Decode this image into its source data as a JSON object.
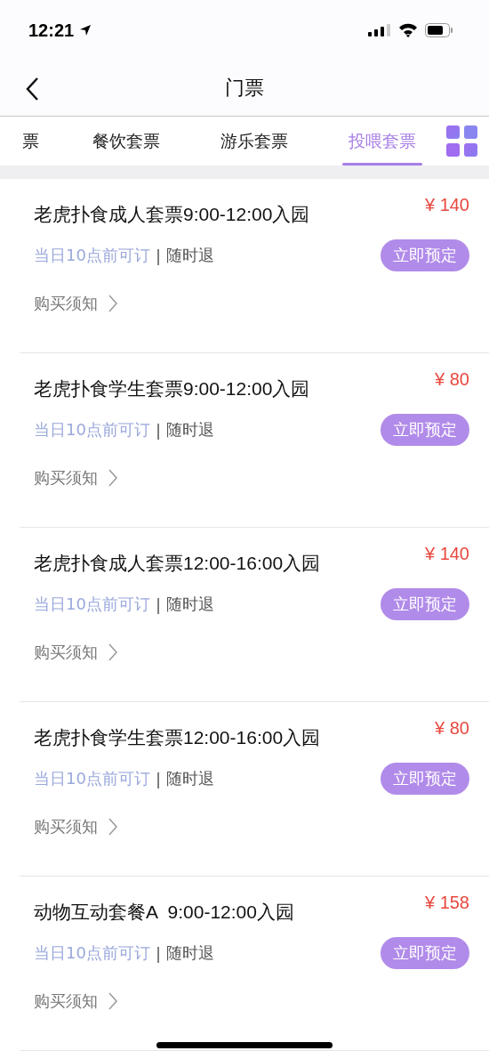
{
  "status_bar": {
    "time": "12:21"
  },
  "nav": {
    "title": "门票"
  },
  "tabs": [
    {
      "label": "票",
      "selected": false
    },
    {
      "label": "餐饮套票",
      "selected": false
    },
    {
      "label": "游乐套票",
      "selected": false
    },
    {
      "label": "投喂套票",
      "selected": true
    }
  ],
  "tickets": [
    {
      "title": "老虎扑食成人套票9:00-12:00入园",
      "currency": "¥",
      "price": "140",
      "booking_note": "当日10点前可订",
      "separator": "|",
      "refund_note": "随时退",
      "button": "立即预定",
      "notice": "购买须知"
    },
    {
      "title": "老虎扑食学生套票9:00-12:00入园",
      "currency": "¥",
      "price": "80",
      "booking_note": "当日10点前可订",
      "separator": "|",
      "refund_note": "随时退",
      "button": "立即预定",
      "notice": "购买须知"
    },
    {
      "title": "老虎扑食成人套票12:00-16:00入园",
      "currency": "¥",
      "price": "140",
      "booking_note": "当日10点前可订",
      "separator": "|",
      "refund_note": "随时退",
      "button": "立即预定",
      "notice": "购买须知"
    },
    {
      "title": "老虎扑食学生套票12:00-16:00入园",
      "currency": "¥",
      "price": "80",
      "booking_note": "当日10点前可订",
      "separator": "|",
      "refund_note": "随时退",
      "button": "立即预定",
      "notice": "购买须知"
    },
    {
      "title": "动物互动套餐A  9:00-12:00入园",
      "currency": "¥",
      "price": "158",
      "booking_note": "当日10点前可订",
      "separator": "|",
      "refund_note": "随时退",
      "button": "立即预定",
      "notice": "购买须知"
    }
  ]
}
